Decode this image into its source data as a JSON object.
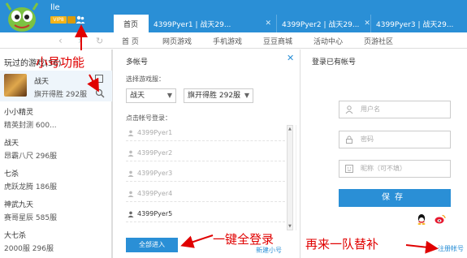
{
  "user": {
    "name": "lle",
    "vip_badge": "VIP8"
  },
  "tabs": [
    {
      "label": "首页"
    },
    {
      "label": "4399Pyer1 | 战天29..."
    },
    {
      "label": "4399Pyer2 | 战天29..."
    },
    {
      "label": "4399Pyer3 | 战天29..."
    }
  ],
  "nav": {
    "links": [
      "首 页",
      "网页游戏",
      "手机游戏",
      "豆豆商城",
      "活动中心",
      "页游社区"
    ]
  },
  "left": {
    "title": "玩过的游戏(36)",
    "first_game": {
      "name": "战天",
      "server": "旗开得胜 292服"
    },
    "games": [
      {
        "name": "小小精灵",
        "server": "精英封测 600..."
      },
      {
        "name": "战天",
        "server": "昂霸八尺 296服"
      },
      {
        "name": "七杀",
        "server": "虎跃龙腾 186服"
      },
      {
        "name": "神武九天",
        "server": "赛哥星辰 585服"
      },
      {
        "name": "大七杀",
        "server": "2000服 296服"
      }
    ]
  },
  "popup": {
    "title": "多帐号",
    "close": "✕",
    "select_label": "选择游戏服：",
    "game_select": "战天",
    "server_select": "旗开得胜 292服",
    "click_label": "点击帐号登录：",
    "accounts": [
      "4399Pyer1",
      "4399Pyer2",
      "4399Pyer3",
      "4399Pyer4",
      "4399Pyer5"
    ],
    "all_login_button": "全部进入",
    "new_small_link": "新建小号"
  },
  "right": {
    "title": "登录已有帐号",
    "username_placeholder": "用户名",
    "password_placeholder": "密码",
    "nickname_placeholder": "昵称（可不填）",
    "save_button": "保存",
    "register_link": "注册帐号"
  },
  "annotations": {
    "small_account": "小号功能",
    "one_click_login": "一键全登录",
    "substitute": "再来一队替补"
  },
  "colors": {
    "brand_blue": "#2a8fd6",
    "annotation_red": "#e00000"
  }
}
